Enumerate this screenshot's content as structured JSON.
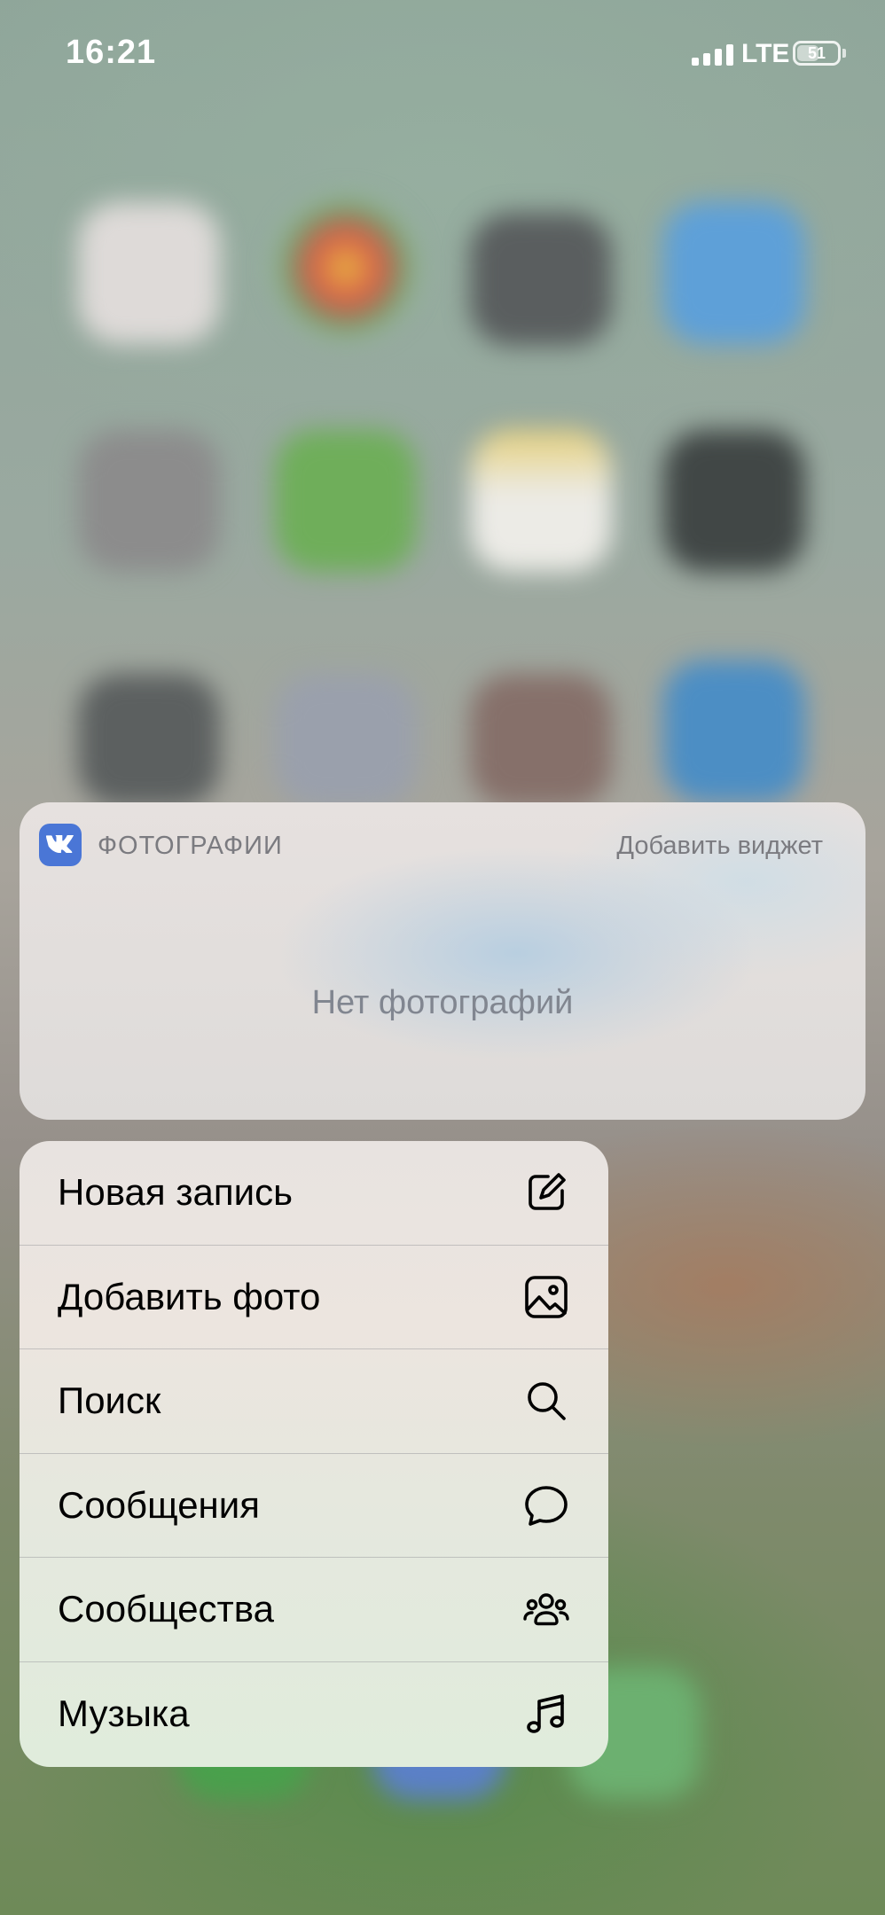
{
  "status_bar": {
    "time": "16:21",
    "network": "LTE",
    "battery_level": "51"
  },
  "widget": {
    "app_icon": "vk-logo",
    "title": "ФОТОГРАФИИ",
    "add_widget_label": "Добавить виджет",
    "empty_text": "Нет фотографий"
  },
  "menu": {
    "items": [
      {
        "label": "Новая запись",
        "icon": "compose-icon"
      },
      {
        "label": "Добавить фото",
        "icon": "photo-icon"
      },
      {
        "label": "Поиск",
        "icon": "search-icon"
      },
      {
        "label": "Сообщения",
        "icon": "chat-bubble-icon"
      },
      {
        "label": "Сообщества",
        "icon": "groups-icon"
      },
      {
        "label": "Музыка",
        "icon": "music-note-icon"
      }
    ]
  },
  "colors": {
    "vk_blue": "#4a76d6",
    "secondary_text": "#7b7b80"
  }
}
